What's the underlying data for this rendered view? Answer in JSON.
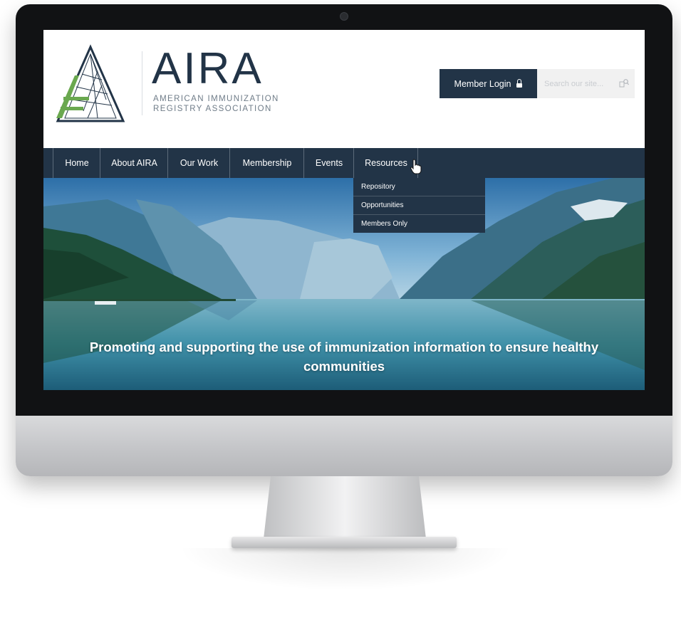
{
  "brand": {
    "name": "AIRA",
    "tagline": "AMERICAN IMMUNIZATION REGISTRY ASSOCIATION",
    "colors": {
      "navy": "#223447",
      "green": "#6aa84f"
    }
  },
  "header": {
    "login_label": "Member Login",
    "login_icon": "lock-icon",
    "search_placeholder": "Search our site...",
    "search_icon": "search-icon"
  },
  "nav": {
    "items": [
      {
        "label": "Home"
      },
      {
        "label": "About AIRA"
      },
      {
        "label": "Our Work"
      },
      {
        "label": "Membership"
      },
      {
        "label": "Events"
      },
      {
        "label": "Resources"
      }
    ],
    "open_menu": "Resources",
    "dropdown": [
      {
        "label": "Repository"
      },
      {
        "label": "Opportunities"
      },
      {
        "label": "Members Only"
      }
    ]
  },
  "hero": {
    "text": "Promoting and supporting the use of immunization information to ensure healthy communities"
  }
}
